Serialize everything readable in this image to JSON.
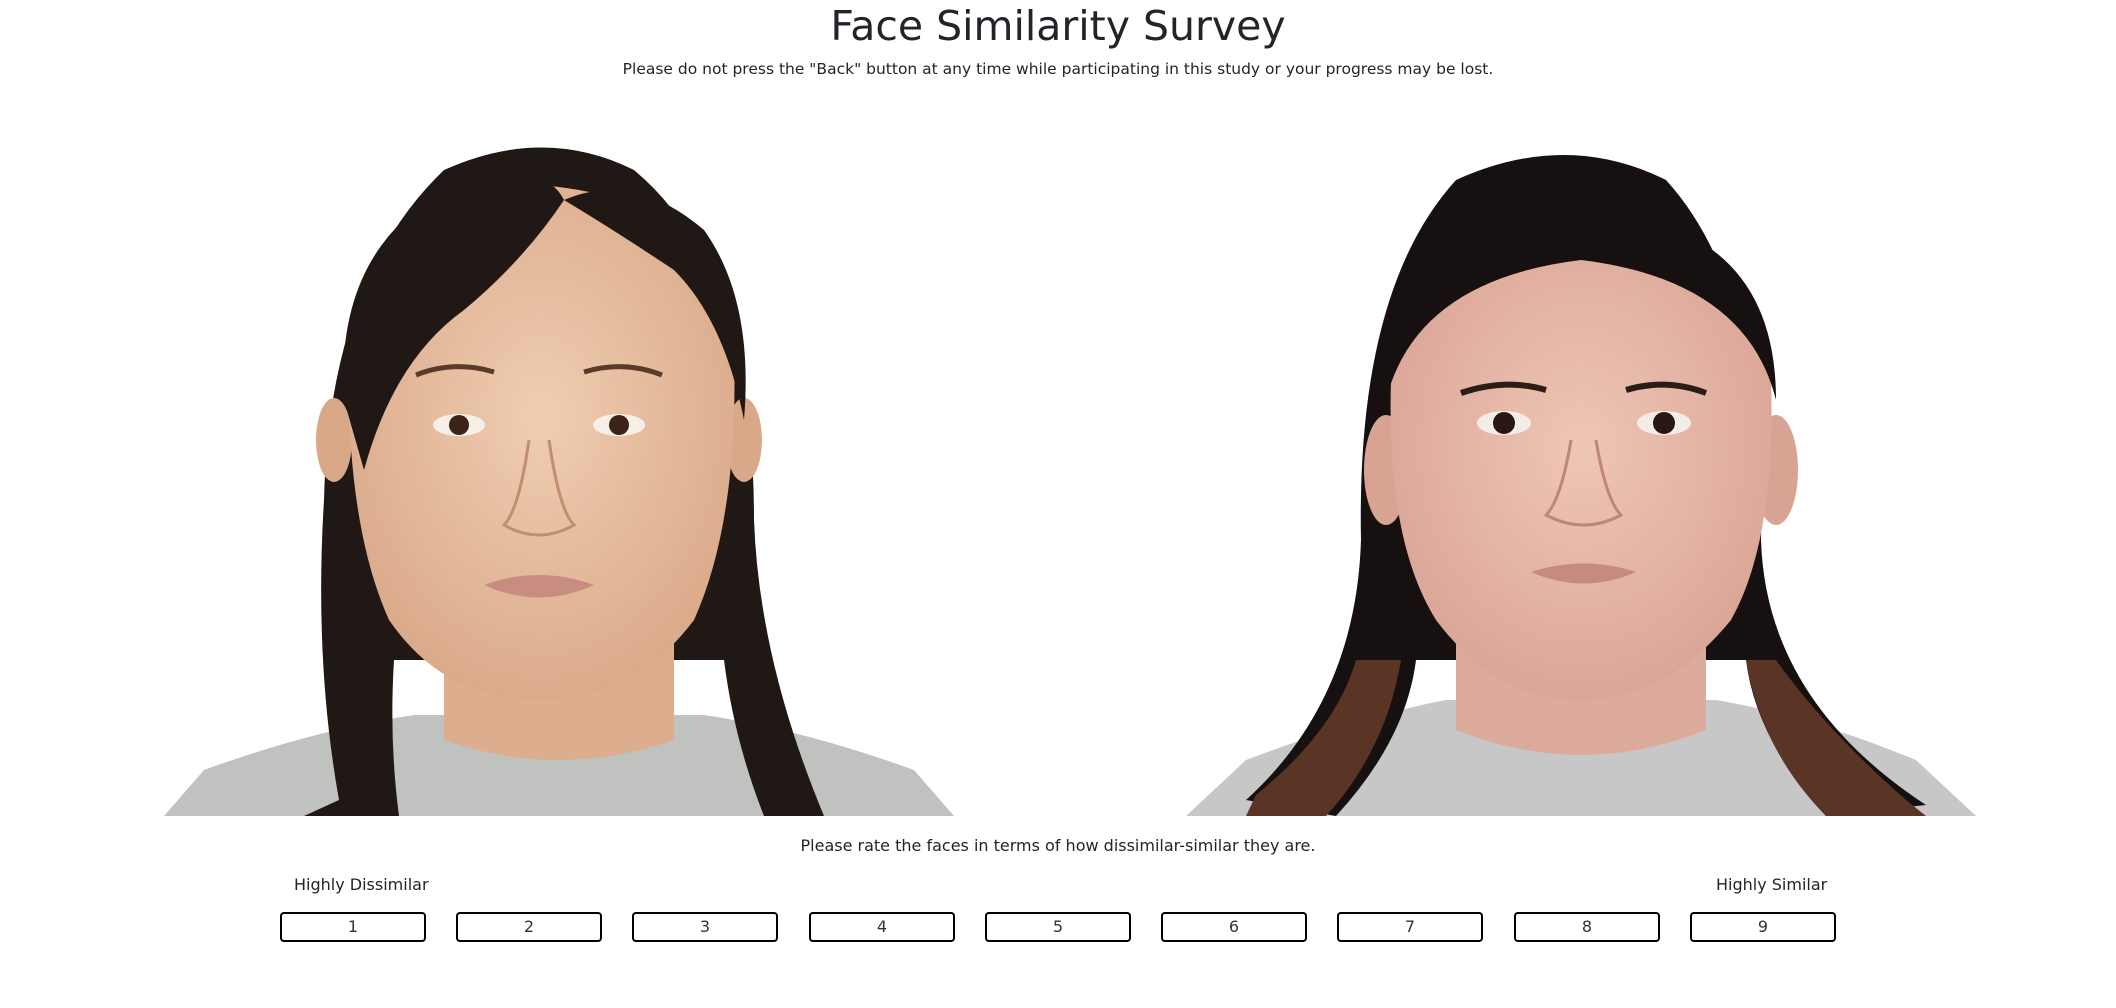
{
  "header": {
    "title": "Face Similarity Survey",
    "notice": "Please do not press the \"Back\" button at any time while participating in this study or your progress may be lost."
  },
  "faces": {
    "left": {
      "hair_color": "#1b1512",
      "skin_color": "#e8c2a5",
      "shirt_color": "#bfc2bf"
    },
    "right": {
      "hair_color": "#15100d",
      "skin_color": "#e6b6a6",
      "shirt_color": "#c7c7c7"
    }
  },
  "rating": {
    "prompt": "Please rate the faces in terms of how dissimilar-similar they are.",
    "low_anchor": "Highly Dissimilar",
    "high_anchor": "Highly Similar",
    "options": [
      "1",
      "2",
      "3",
      "4",
      "5",
      "6",
      "7",
      "8",
      "9"
    ]
  }
}
